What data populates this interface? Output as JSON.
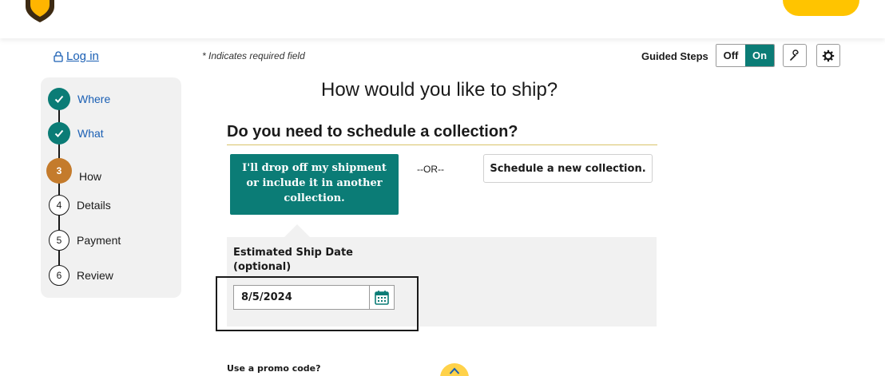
{
  "header": {
    "logo_icon": "ups-shield-logo",
    "cta_color": "#ffc400"
  },
  "login": {
    "label": "Log in",
    "icon": "lock-icon"
  },
  "form": {
    "required_note": "* Indicates required field",
    "main_heading": "How would you like to ship?",
    "collection_heading": "Do you need to schedule a collection?",
    "dropoff_label": "I'll drop off my shipment or include it in another collection.",
    "or_label": "--OR--",
    "schedule_label": "Schedule a new collection.",
    "ship_date_label": "Estimated Ship Date (optional)",
    "ship_date_value": "8/5/2024",
    "promo_label": "Use a promo code?"
  },
  "guided_steps": {
    "label": "Guided Steps",
    "off": "Off",
    "on": "On",
    "selected": "On"
  },
  "steps": [
    {
      "number": "",
      "label": "Where",
      "state": "done"
    },
    {
      "number": "",
      "label": "What",
      "state": "done"
    },
    {
      "number": "3",
      "label": "How",
      "state": "current"
    },
    {
      "number": "4",
      "label": "Details",
      "state": "future"
    },
    {
      "number": "5",
      "label": "Payment",
      "state": "future"
    },
    {
      "number": "6",
      "label": "Review",
      "state": "future"
    }
  ],
  "colors": {
    "accent": "#0b7c76",
    "current_step": "#c47b2c",
    "link": "#1a5fb4"
  }
}
